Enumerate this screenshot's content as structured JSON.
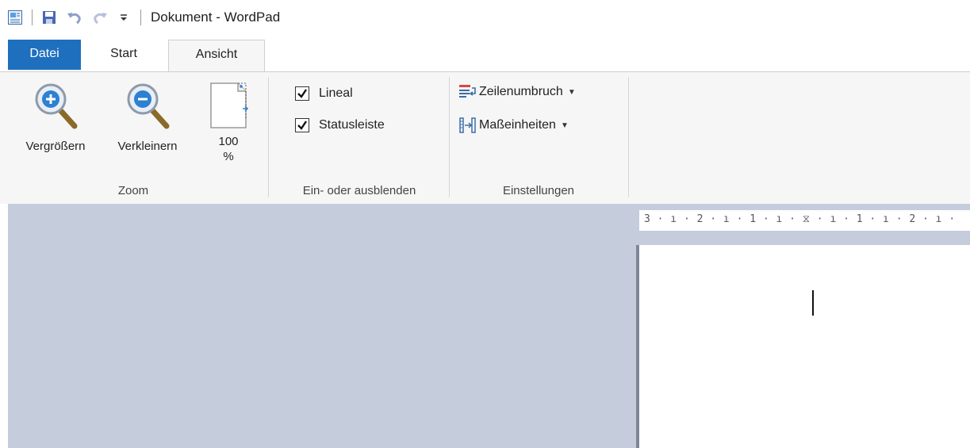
{
  "window": {
    "title": "Dokument - WordPad"
  },
  "quick_access": {
    "icons": [
      "wordpad-app-icon",
      "save-icon",
      "undo-icon",
      "redo-icon",
      "customize-dropdown-icon"
    ]
  },
  "tabs": [
    {
      "label": "Datei",
      "active": false,
      "color": "#1f6fbf"
    },
    {
      "label": "Start",
      "active": false
    },
    {
      "label": "Ansicht",
      "active": true
    }
  ],
  "ribbon": {
    "zoom_group": {
      "label": "Zoom",
      "zoom_in": "Vergrößern",
      "zoom_out": "Verkleinern",
      "zoom_100_line1": "100",
      "zoom_100_line2": "%"
    },
    "show_hide_group": {
      "label": "Ein- oder ausblenden",
      "ruler": {
        "label": "Lineal",
        "checked": true
      },
      "statusbar": {
        "label": "Statusleiste",
        "checked": true
      }
    },
    "settings_group": {
      "label": "Einstellungen",
      "word_wrap": "Zeilenumbruch",
      "units": "Maßeinheiten"
    }
  },
  "ruler": {
    "text": "3 · ı · 2 · ı · 1 · ı · ⧖ · ı · 1 · ı · 2 · ı ·"
  },
  "colors": {
    "accent": "#1f6fbf",
    "workspace": "#c5cddd",
    "ribbon_bg": "#f6f6f6"
  }
}
